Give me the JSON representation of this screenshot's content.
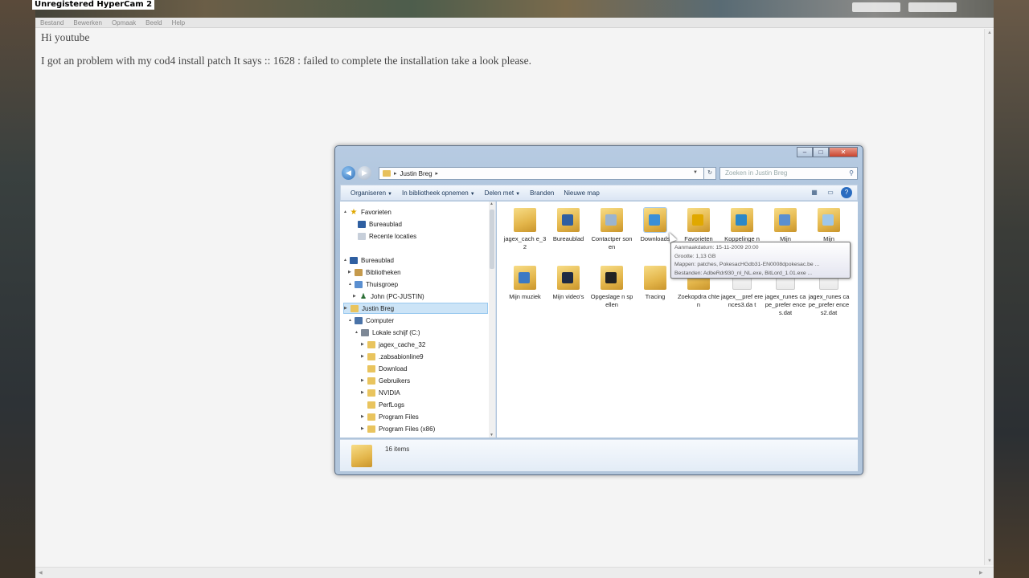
{
  "recorder_title": "Unregistered HyperCam 2",
  "menu": [
    "Bestand",
    "Bewerken",
    "Opmaak",
    "Beeld",
    "Help"
  ],
  "document": {
    "line1": "Hi youtube",
    "line2": "I got an problem with my cod4 install patch It says :: 1628 : failed to complete the installation take a look please."
  },
  "explorer": {
    "address_path": "Justin Breg",
    "search_placeholder": "Zoeken in Justin Breg",
    "toolbar": [
      {
        "label": "Organiseren",
        "has_dropdown": true
      },
      {
        "label": "In bibliotheek opnemen",
        "has_dropdown": true
      },
      {
        "label": "Delen met",
        "has_dropdown": true
      },
      {
        "label": "Branden",
        "has_dropdown": false
      },
      {
        "label": "Nieuwe map",
        "has_dropdown": false
      }
    ],
    "nav": [
      {
        "label": "Favorieten",
        "icon": "star-icon",
        "expander": "▲"
      },
      {
        "label": "Bureaublad",
        "icon": "desktop-icon",
        "expander": ""
      },
      {
        "label": "Recente locaties",
        "icon": "recent-places-icon",
        "expander": ""
      },
      {
        "label": "Bureaublad",
        "icon": "desktop-icon",
        "expander": "▲"
      },
      {
        "label": "Bibliotheken",
        "icon": "library-icon",
        "expander": "▶"
      },
      {
        "label": "Thuisgroep",
        "icon": "homegroup-icon",
        "expander": "▲"
      },
      {
        "label": "John (PC-JUSTIN)",
        "icon": "user-icon",
        "expander": "▶"
      },
      {
        "label": "Justin Breg",
        "icon": "user-folder-icon",
        "expander": "▶",
        "selected": true
      },
      {
        "label": "Computer",
        "icon": "computer-icon",
        "expander": "▲"
      },
      {
        "label": "Lokale schijf (C:)",
        "icon": "drive-icon",
        "expander": "▲"
      },
      {
        "label": "jagex_cache_32",
        "icon": "folder-icon",
        "expander": "▶"
      },
      {
        "label": ".zabsabionline9",
        "icon": "folder-icon",
        "expander": "▶"
      },
      {
        "label": "Download",
        "icon": "folder-icon",
        "expander": ""
      },
      {
        "label": "Gebruikers",
        "icon": "folder-icon",
        "expander": "▶"
      },
      {
        "label": "NVIDIA",
        "icon": "folder-icon",
        "expander": "▶"
      },
      {
        "label": "PerfLogs",
        "icon": "folder-icon",
        "expander": ""
      },
      {
        "label": "Program Files",
        "icon": "folder-icon",
        "expander": "▶"
      },
      {
        "label": "Program Files (x86)",
        "icon": "folder-icon",
        "expander": "▶"
      }
    ],
    "items_row1": [
      {
        "label": "jagex_cach e_32",
        "icon": "folder-icon"
      },
      {
        "label": "Bureaublad",
        "icon": "desktop-folder-icon"
      },
      {
        "label": "Contactper sonen",
        "icon": "contacts-folder-icon"
      },
      {
        "label": "Downloads",
        "icon": "downloads-folder-icon"
      },
      {
        "label": "Favorieten",
        "icon": "favorites-folder-icon"
      },
      {
        "label": "Koppelinge n",
        "icon": "links-folder-icon"
      },
      {
        "label": "Mijn",
        "icon": "documents-folder-icon"
      },
      {
        "label": "Mijn",
        "icon": "pictures-folder-icon"
      }
    ],
    "items_row2": [
      {
        "label": "Mijn muziek",
        "icon": "music-folder-icon"
      },
      {
        "label": "Mijn video's",
        "icon": "videos-folder-icon"
      },
      {
        "label": "Opgeslage n spellen",
        "icon": "saved-games-folder-icon"
      },
      {
        "label": "Tracing",
        "icon": "folder-icon"
      },
      {
        "label": "Zoekopdra chten",
        "icon": "searches-folder-icon"
      },
      {
        "label": "jagex__pref erences3.da t",
        "icon": "file-icon"
      },
      {
        "label": "jagex_runes cape_prefer ences.dat",
        "icon": "file-icon"
      },
      {
        "label": "jagex_runes cape_prefer ences2.dat",
        "icon": "file-icon"
      }
    ],
    "tooltip": [
      "Aanmaakdatum: 15-11-2009 20:00",
      "Grootte: 1,13 GB",
      "Mappen: patches, PokesacHGdb31-EN0008dpokesac.be ...",
      "Bestanden: AdbeRdr930_nl_NL.exe, BitLord_1.01.exe ..."
    ],
    "status_count": "16 items",
    "colors": {
      "accent": "#2a6cc0",
      "selection": "#cce4f7",
      "folder": "#e3b54a"
    }
  }
}
